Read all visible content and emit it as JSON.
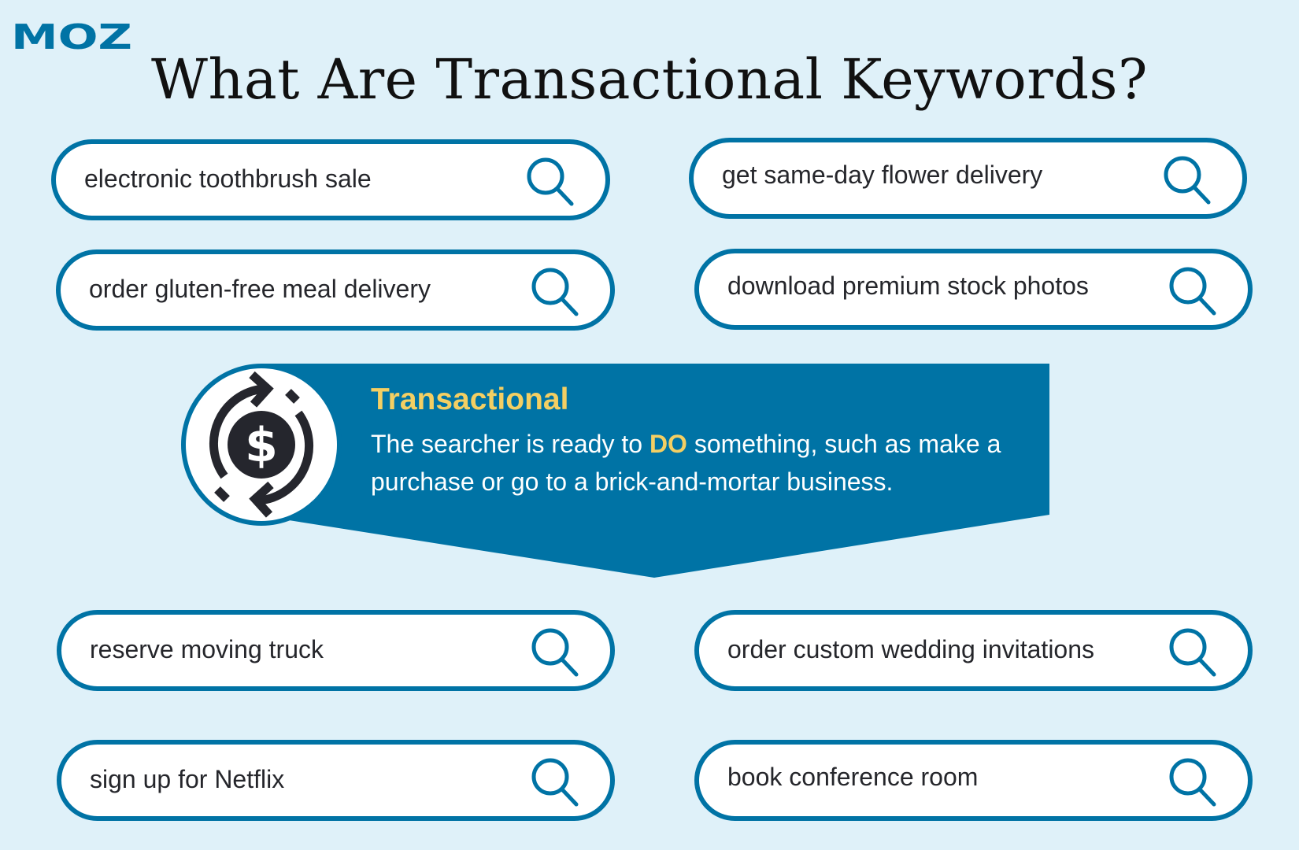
{
  "brand": {
    "logo_text": "MOZ",
    "logo_color": "#0073a5"
  },
  "title": "What Are Transactional Keywords?",
  "colors": {
    "background": "#dff1f9",
    "accent_blue": "#0073a5",
    "highlight_yellow": "#f4cf63",
    "text_dark": "#25262b"
  },
  "search_boxes": [
    {
      "query": "electronic toothbrush sale",
      "icon": "search-icon"
    },
    {
      "query": "get same-day flower delivery",
      "icon": "search-icon"
    },
    {
      "query": "order gluten-free meal delivery",
      "icon": "search-icon"
    },
    {
      "query": "download premium stock photos",
      "icon": "search-icon"
    },
    {
      "query": "reserve moving truck",
      "icon": "search-icon"
    },
    {
      "query": "order custom wedding invitations",
      "icon": "search-icon"
    },
    {
      "query": "sign up for Netflix",
      "icon": "search-icon"
    },
    {
      "query": "book conference room",
      "icon": "search-icon"
    }
  ],
  "callout": {
    "icon": "dollar-exchange-icon",
    "heading": "Transactional",
    "body_part1": "The searcher is ready to ",
    "body_highlight": "DO",
    "body_part2": " something, such as make a purchase or go to a brick-and-mortar business."
  }
}
